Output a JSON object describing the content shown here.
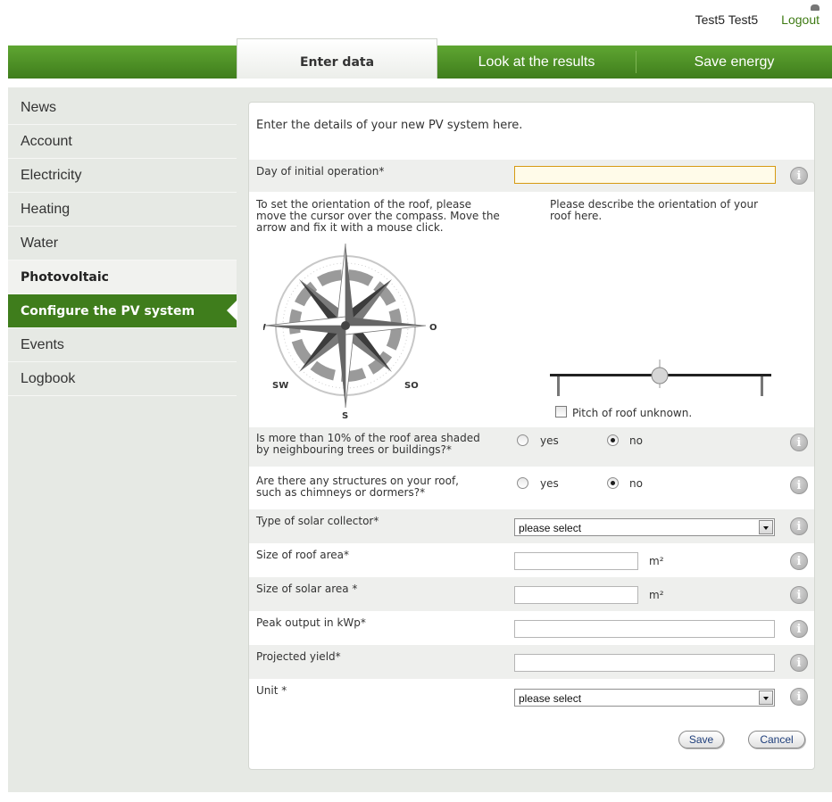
{
  "user": {
    "name": "Test5 Test5",
    "logout_label": "Logout"
  },
  "nav": {
    "tabs": [
      {
        "label": "Enter data"
      },
      {
        "label": "Look at the results"
      },
      {
        "label": "Save energy"
      }
    ]
  },
  "sidebar": {
    "items": [
      {
        "label": "News"
      },
      {
        "label": "Account"
      },
      {
        "label": "Electricity"
      },
      {
        "label": "Heating"
      },
      {
        "label": "Water"
      },
      {
        "label": "Photovoltaic"
      },
      {
        "label": "Configure the PV system"
      },
      {
        "label": "Events"
      },
      {
        "label": "Logbook"
      }
    ]
  },
  "form": {
    "intro": "Enter the details of your new PV system here.",
    "day_label": "Day of initial operation*",
    "day_value": "",
    "compass_help_1": "To set the orientation of the roof, please",
    "compass_help_2": "move the cursor over the compass. Move the",
    "compass_help_3": "arrow and fix it with a mouse click.",
    "orientation_help_1": "Please describe the orientation of your",
    "orientation_help_2": "roof here.",
    "compass": {
      "w": "W",
      "o": "O",
      "sw": "SW",
      "so": "SO",
      "s": "S"
    },
    "pitch_unknown_label": "Pitch of roof unknown.",
    "pitch_unknown_checked": false,
    "shaded_label_1": "Is more than 10% of the roof area shaded",
    "shaded_label_2": "by neighbouring trees or buildings?*",
    "structures_label_1": "Are there any structures on your roof,",
    "structures_label_2": "such as chimneys or dormers?*",
    "yes_label": "yes",
    "no_label": "no",
    "shaded_value": "no",
    "structures_value": "no",
    "collector_label": "Type of solar collector*",
    "collector_value": "please select",
    "roof_area_label": "Size of roof area*",
    "roof_area_value": "",
    "solar_area_label": "Size of solar area *",
    "solar_area_value": "",
    "area_unit": "m²",
    "peak_label": "Peak output in kWp*",
    "peak_value": "",
    "yield_label": "Projected yield*",
    "yield_value": "",
    "unit_label": "Unit *",
    "unit_value": "please select",
    "info_glyph": "i",
    "save_label": "Save",
    "cancel_label": "Cancel"
  },
  "colors": {
    "brand_green": "#3f7d1c",
    "focus_border": "#d69a12"
  }
}
